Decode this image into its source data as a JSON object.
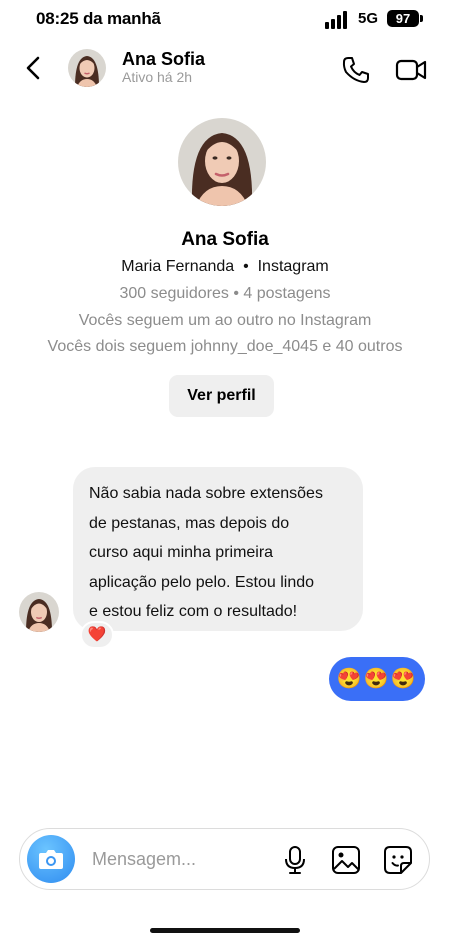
{
  "status_bar": {
    "time": "08:25 da manhã",
    "network": "5G",
    "battery": "97",
    "signal_icon": "signal-bars-icon"
  },
  "header": {
    "back_icon": "chevron-left-icon",
    "name": "Ana Sofia",
    "status": "Ativo há 2h",
    "call_icon": "phone-icon",
    "video_icon": "video-camera-icon"
  },
  "profile": {
    "name": "Ana Sofia",
    "full_name": "Maria Fernanda",
    "platform": "Instagram",
    "stats": "300 seguidores • 4 postagens",
    "mutual_follow": "Vocês seguem um ao outro no Instagram",
    "mutual_friends": "Vocês dois seguem johnny_doe_4045 e 40 outros",
    "view_profile_label": "Ver perfil"
  },
  "messages": [
    {
      "direction": "incoming",
      "lines": [
        "Não sabia nada sobre extensões",
        "de pestanas, mas depois do",
        "curso aqui minha primeira",
        "aplicação pelo pelo. Estou lindo",
        "e estou feliz com o resultado!"
      ],
      "reaction": "❤️"
    },
    {
      "direction": "outgoing",
      "text": "😍😍😍"
    }
  ],
  "composer": {
    "placeholder": "Mensagem...",
    "camera_icon": "camera-icon",
    "mic_icon": "microphone-icon",
    "gallery_icon": "image-icon",
    "sticker_icon": "sticker-icon"
  },
  "colors": {
    "outgoing_bubble": "#3a6ff7",
    "incoming_bubble": "#efefef",
    "camera_button": "#2f8cf0",
    "secondary_text": "#8c8c8c"
  }
}
